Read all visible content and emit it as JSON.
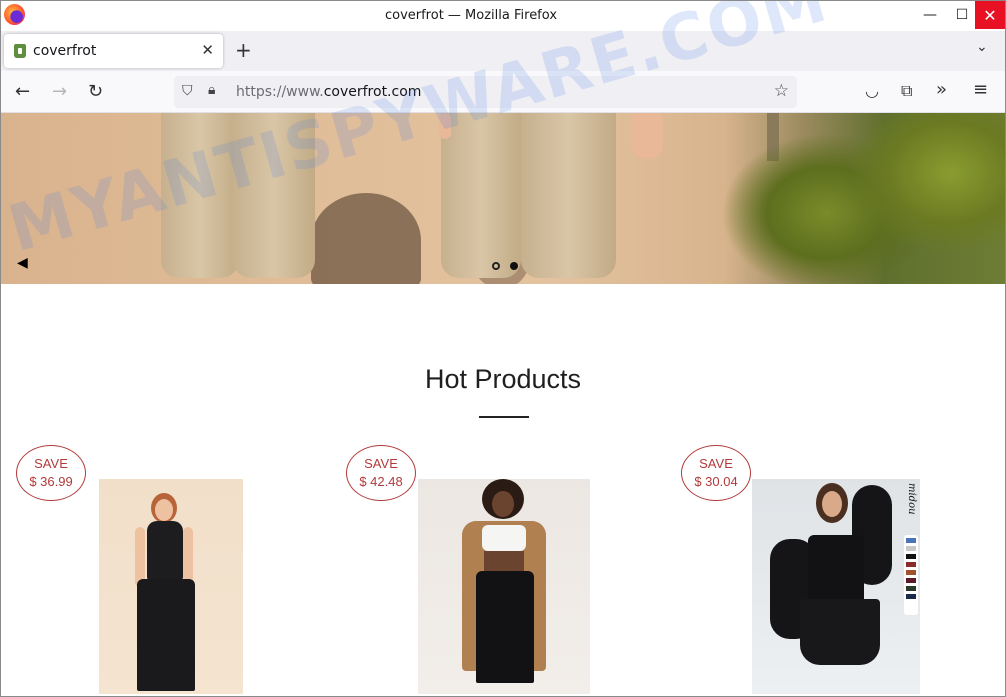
{
  "window": {
    "title": "coverfrot — Mozilla Firefox",
    "controls": {
      "minimize": "—",
      "maximize": "☐",
      "close": "✕"
    }
  },
  "tabs": [
    {
      "label": "coverfrot",
      "active": true
    }
  ],
  "toolbar": {
    "url_prefix": "https://www.",
    "url_domain": "coverfrot.com"
  },
  "hero": {
    "slides": 2,
    "active_slide": 2
  },
  "main": {
    "section_title": "Hot Products",
    "products": [
      {
        "save_label": "SAVE",
        "price": "$ 36.99"
      },
      {
        "save_label": "SAVE",
        "price": "$ 42.48"
      },
      {
        "save_label": "SAVE",
        "price": "$ 30.04"
      }
    ]
  },
  "watermark": "MYANTISPYWARE.COM",
  "colors": {
    "badge": "#b23a3a",
    "close_button": "#e81123",
    "watermark": "#5082e6"
  },
  "icons": [
    "firefox-logo-icon",
    "shopify-favicon-icon",
    "back-icon",
    "forward-icon",
    "reload-icon",
    "shield-icon",
    "lock-icon",
    "bookmark-star-icon",
    "pocket-icon",
    "extensions-icon",
    "overflow-icon",
    "menu-icon"
  ]
}
